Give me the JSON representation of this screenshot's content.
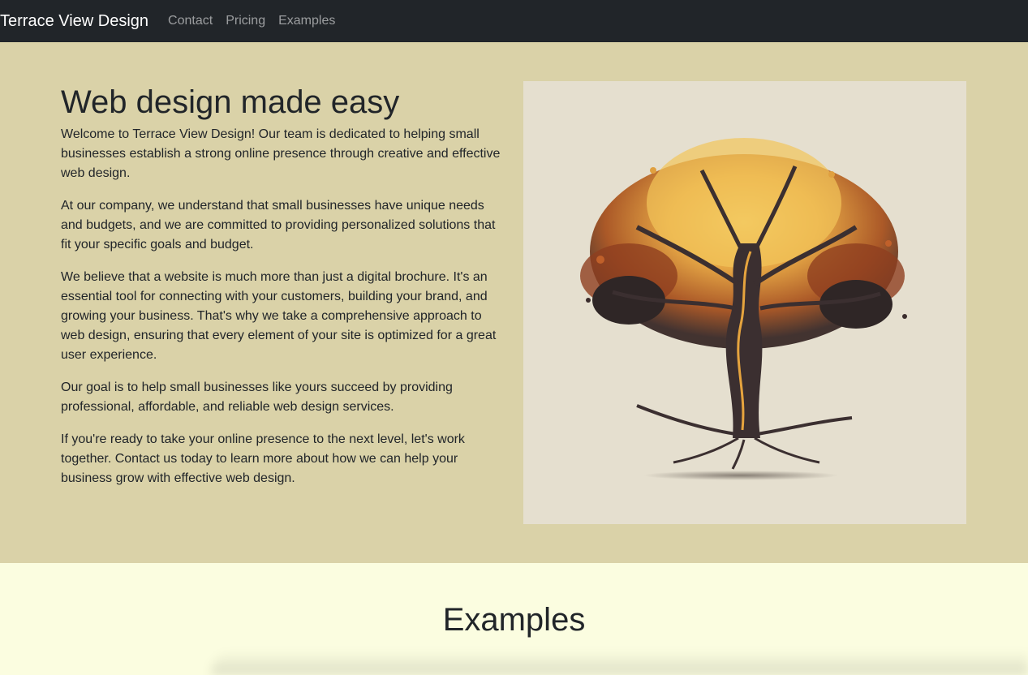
{
  "navbar": {
    "brand": "Terrace View Design",
    "links": [
      "Contact",
      "Pricing",
      "Examples"
    ]
  },
  "hero": {
    "title": "Web design made easy",
    "paragraphs": [
      "Welcome to Terrace View Design! Our team is dedicated to helping small businesses establish a strong online presence through creative and effective web design.",
      "At our company, we understand that small businesses have unique needs and budgets, and we are committed to providing personalized solutions that fit your specific goals and budget.",
      "We believe that a website is much more than just a digital brochure. It's an essential tool for connecting with your customers, building your brand, and growing your business. That's why we take a comprehensive approach to web design, ensuring that every element of your site is optimized for a great user experience.",
      "Our goal is to help small businesses like yours succeed by providing professional, affordable, and reliable web design services.",
      "If you're ready to take your online presence to the next level, let's work together. Contact us today to learn more about how we can help your business grow with effective web design."
    ],
    "image_icon": "autumn-tree-illustration"
  },
  "examples": {
    "title": "Examples"
  },
  "colors": {
    "navbar_bg": "#212529",
    "hero_bg": "#dad2a8",
    "examples_bg": "#fbfde0",
    "image_bg": "#e5dfcf"
  }
}
